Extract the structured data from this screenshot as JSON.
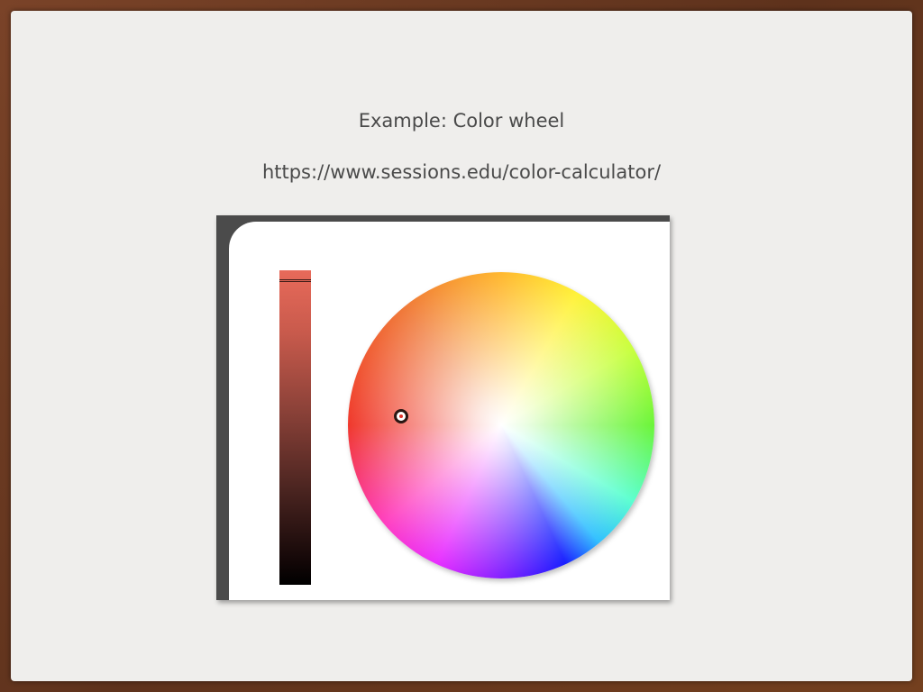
{
  "slide": {
    "title": "Example: Color wheel",
    "url": "https://www.sessions.edu/color-calculator/"
  },
  "color_picker": {
    "selected_color": "#e86a5a",
    "value_level": 0.98,
    "hue_marker_color": "#f03a2e"
  }
}
